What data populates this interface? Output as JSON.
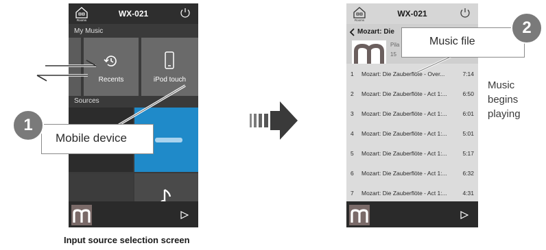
{
  "left_screen": {
    "device_name": "WX-021",
    "rooms_label": "Rooms",
    "section_my_music": "My Music",
    "tiles": [
      {
        "label": "Recents"
      },
      {
        "label": "iPod touch"
      }
    ],
    "section_sources": "Sources",
    "callout_number": "1",
    "callout_text": "Mobile device",
    "caption": "Input source selection screen"
  },
  "right_screen": {
    "device_name": "WX-021",
    "rooms_label": "Rooms",
    "back_title": "Mozart: Die",
    "album_line1": "Pila",
    "album_line2": "15",
    "callout_number": "2",
    "callout_text": "Music file",
    "tracks": [
      {
        "num": "1",
        "name": "Mozart: Die Zauberflöte - Over...",
        "dur": "7:14"
      },
      {
        "num": "2",
        "name": "Mozart: Die Zauberflöte - Act 1:...",
        "dur": "6:50"
      },
      {
        "num": "3",
        "name": "Mozart: Die Zauberflöte - Act 1:...",
        "dur": "6:01"
      },
      {
        "num": "4",
        "name": "Mozart: Die Zauberflöte - Act 1:...",
        "dur": "5:01"
      },
      {
        "num": "5",
        "name": "Mozart: Die Zauberflöte - Act 1:...",
        "dur": "5:17"
      },
      {
        "num": "6",
        "name": "Mozart: Die Zauberflöte - Act 1:...",
        "dur": "6:32"
      },
      {
        "num": "7",
        "name": "Mozart: Die Zauberflöte - Act 1:...",
        "dur": "4:31"
      }
    ],
    "note_lines": [
      "Music",
      "begins",
      "playing"
    ]
  },
  "colors": {
    "phone_dark": "#3a3a3a",
    "tile_blue": "#1f8ac9",
    "badge_gray": "#7a7a7a",
    "arrow_dark": "#3a3a3a"
  },
  "icons": [
    "rooms-icon",
    "power-icon",
    "recents-icon",
    "phone-icon",
    "music-note-icon",
    "play-icon",
    "back-chevron-icon",
    "swipe-arrows-icon",
    "transition-arrow-icon"
  ]
}
